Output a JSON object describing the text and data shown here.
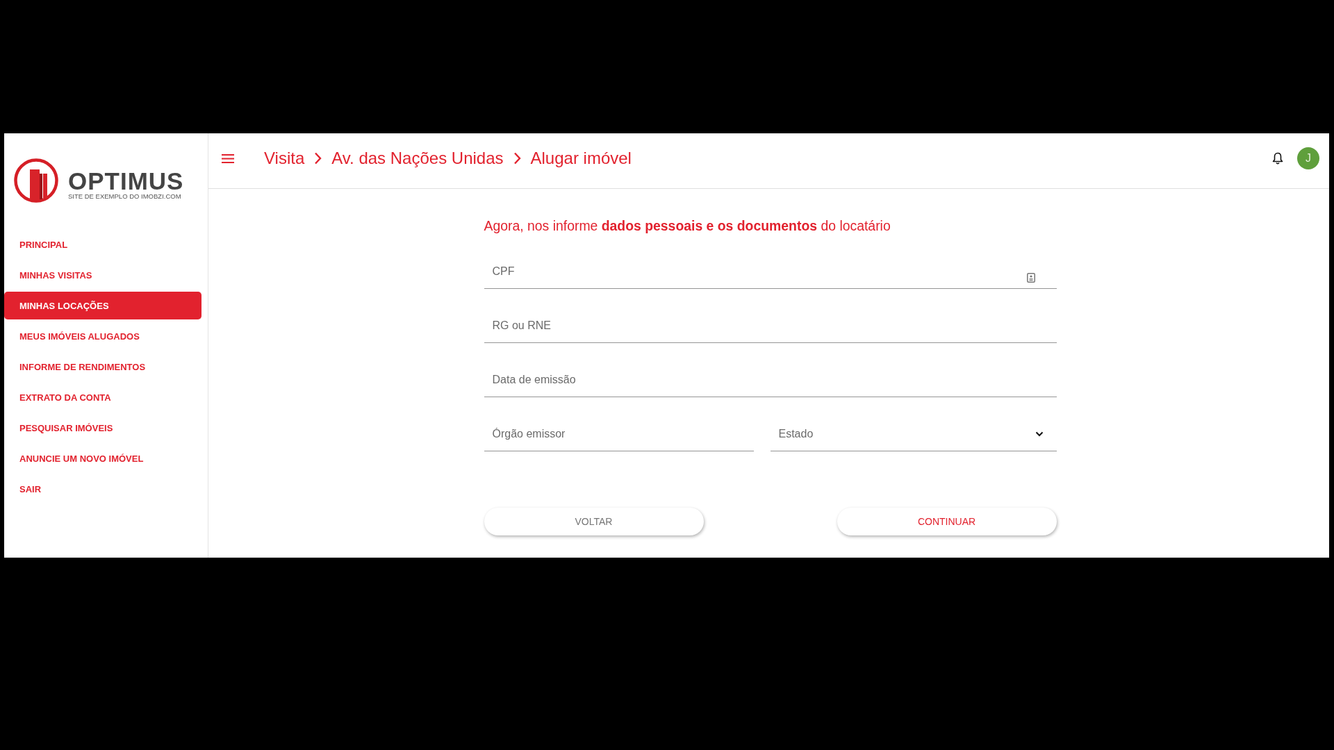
{
  "logo": {
    "name": "OPTIMUS",
    "tagline": "SITE DE EXEMPLO DO IMOBZI.COM"
  },
  "sidebar": {
    "items": [
      {
        "label": "PRINCIPAL",
        "selected": false
      },
      {
        "label": "MINHAS VISITAS",
        "selected": false
      },
      {
        "label": "MINHAS LOCAÇÕES",
        "selected": true
      },
      {
        "label": "MEUS IMÓVEIS ALUGADOS",
        "selected": false
      },
      {
        "label": "INFORME DE RENDIMENTOS",
        "selected": false
      },
      {
        "label": "EXTRATO DA CONTA",
        "selected": false
      },
      {
        "label": "PESQUISAR IMÓVEIS",
        "selected": false
      },
      {
        "label": "ANUNCIE UM NOVO IMÓVEL",
        "selected": false
      },
      {
        "label": "SAIR",
        "selected": false
      }
    ]
  },
  "header": {
    "breadcrumbs": [
      "Visita",
      "Av. das Nações Unidas",
      "Alugar imóvel"
    ],
    "avatar": {
      "initial": "J"
    }
  },
  "form": {
    "heading": "Agora, nos informe **dados pessoais e os documentos** do locatário",
    "rows": [
      {
        "fields": [
          {
            "kind": "contact",
            "placeholder": "CPF"
          }
        ]
      },
      {
        "fields": [
          {
            "kind": "text",
            "placeholder": "RG ou RNE"
          }
        ]
      },
      {
        "fields": [
          {
            "kind": "text",
            "placeholder": "Data de emissão"
          }
        ]
      },
      {
        "fields": [
          {
            "kind": "text",
            "placeholder": "Órgão emissor"
          },
          {
            "kind": "select",
            "placeholder": "Estado"
          }
        ]
      }
    ],
    "buttons": [
      {
        "kind": "secondary",
        "label": "VOLTAR"
      },
      {
        "kind": "primary",
        "label": "CONTINUAR"
      }
    ]
  }
}
